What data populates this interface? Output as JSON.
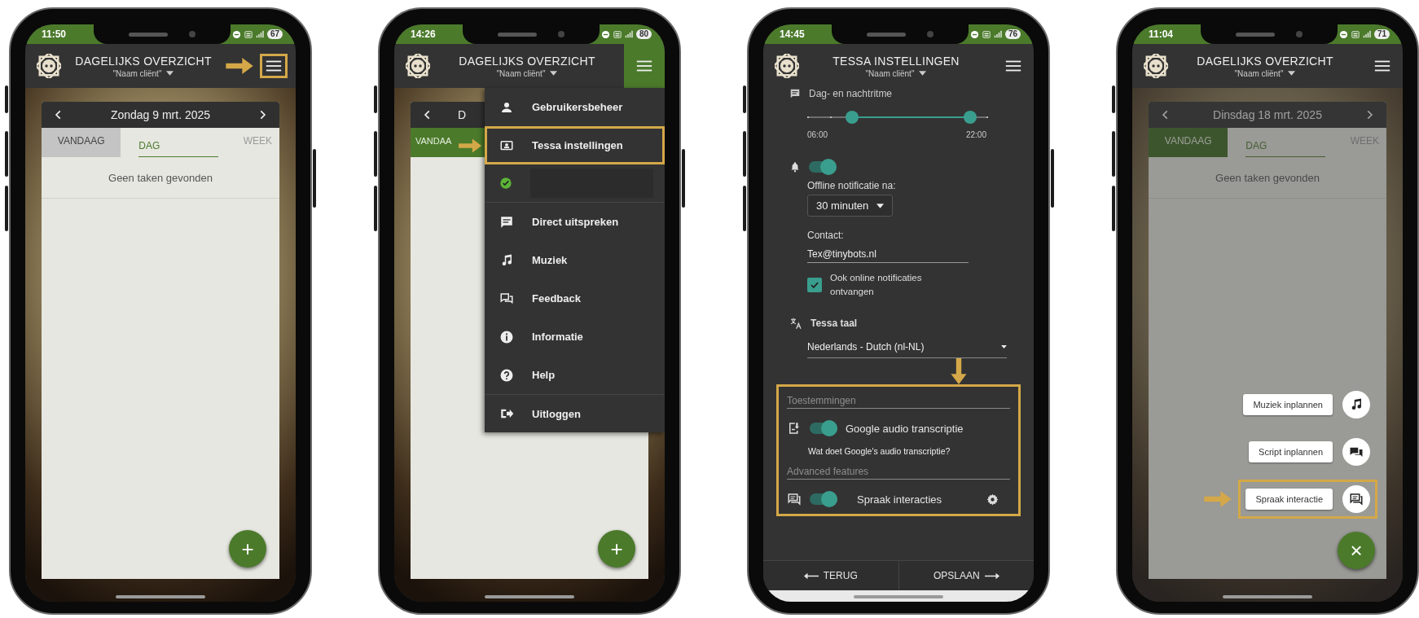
{
  "phones": [
    {
      "kind": "overview",
      "status_bar": {
        "time": "11:50",
        "battery": "67"
      },
      "header": {
        "title": "DAGELIJKS OVERZICHT",
        "subtitle": "\"Naam cliënt\"",
        "menu_highlighted": true,
        "menu_open": false
      },
      "date": "Zondag 9 mrt. 2025",
      "tabs": [
        {
          "label": "VANDAAG",
          "selected": false,
          "filled": true,
          "color": "#c4c4c4"
        },
        {
          "label": "DAG",
          "selected": true,
          "filled": false,
          "color": "#e7e7e1"
        },
        {
          "label": "WEEK",
          "selected": false,
          "filled": false,
          "color": "#e7e7e1"
        }
      ],
      "empty_text": "Geen taken gevonden",
      "fab": "+"
    },
    {
      "kind": "menu",
      "status_bar": {
        "time": "14:26",
        "battery": "80"
      },
      "header": {
        "title": "DAGELIJKS OVERZICHT",
        "subtitle": "\"Naam cliënt\"",
        "menu_highlighted": false,
        "menu_open": true
      },
      "date": "D",
      "tabs": [
        {
          "label": "VANDAA",
          "selected": false,
          "filled": true,
          "color": "#4b7a2b"
        }
      ],
      "fab": "+",
      "menu": [
        {
          "kind": "item",
          "label": "Gebruikersbeheer",
          "highlighted": false
        },
        {
          "kind": "item",
          "label": "Tessa instellingen",
          "highlighted": true
        },
        {
          "kind": "status",
          "highlighted": false
        },
        {
          "kind": "item",
          "label": "Direct uitspreken",
          "highlighted": false
        },
        {
          "kind": "item",
          "label": "Muziek",
          "highlighted": false
        },
        {
          "kind": "item",
          "label": "Feedback",
          "highlighted": false
        },
        {
          "kind": "item",
          "label": "Informatie",
          "highlighted": false
        },
        {
          "kind": "item",
          "label": "Help",
          "highlighted": false
        },
        {
          "kind": "item",
          "label": "Uitloggen",
          "highlighted": false
        }
      ]
    },
    {
      "kind": "settings",
      "status_bar": {
        "time": "14:45",
        "battery": "76"
      },
      "header": {
        "title": "TESSA INSTELLINGEN",
        "subtitle": "\"Naam cliënt\"",
        "menu_highlighted": false,
        "menu_open": false
      },
      "settings": {
        "rhythm": {
          "label": "Dag- en nachtritme",
          "thumbs": [
            {
              "level": 0.25
            },
            {
              "level": 0.91
            }
          ],
          "start": "06:00",
          "end": "22:00"
        },
        "notification": {
          "on": true,
          "label": "Offline notificatie na:",
          "value": "30 minuten"
        },
        "contact": {
          "label": "Contact:",
          "value": "Tex@tinybots.nl"
        },
        "online": {
          "label": "Ook online notificaties ontvangen",
          "checked": true
        },
        "language": {
          "label": "Tessa taal",
          "value": "Nederlands - Dutch (nl-NL)"
        },
        "permissions": {
          "highlighted": true,
          "title": "Toestemmingen",
          "google": {
            "label": "Google audio transcriptie",
            "on": true
          },
          "link": "Wat doet Google's audio transcriptie?",
          "advanced_title": "Advanced features",
          "speech": {
            "label": "Spraak interacties",
            "on": true
          }
        },
        "footer": {
          "back": "TERUG",
          "save": "OPSLAAN"
        }
      }
    },
    {
      "kind": "speed_dial",
      "status_bar": {
        "time": "11:04",
        "battery": "71"
      },
      "header": {
        "title": "DAGELIJKS OVERZICHT",
        "subtitle": "\"Naam cliënt\"",
        "menu_highlighted": false,
        "menu_open": false
      },
      "date": "Dinsdag 18 mrt. 2025",
      "tabs": [
        {
          "label": "VANDAAG",
          "selected": false,
          "filled": true
        },
        {
          "label": "DAG",
          "selected": true,
          "filled": false
        },
        {
          "label": "WEEK",
          "selected": false,
          "filled": false
        }
      ],
      "empty_text": "Geen taken gevonden",
      "speed_dial": [
        {
          "label": "Muziek inplannen",
          "highlighted": false
        },
        {
          "label": "Script inplannen",
          "highlighted": false
        },
        {
          "label": "Spraak interactie",
          "highlighted": true
        }
      ],
      "fab": "×"
    }
  ]
}
